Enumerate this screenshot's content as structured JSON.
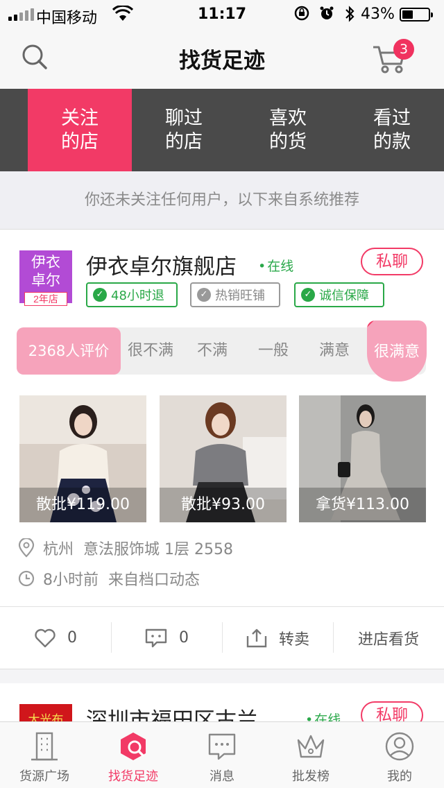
{
  "status_bar": {
    "carrier": "中国移动",
    "time": "11:17",
    "battery_pct": "43%",
    "battery_level": 0.43,
    "icons": [
      "signal-icon",
      "wifi-icon",
      "rotation-lock-icon",
      "alarm-icon",
      "bluetooth-icon",
      "battery-icon"
    ]
  },
  "header": {
    "title": "找货足迹",
    "cart_count": "3",
    "icons": [
      "search-icon",
      "cart-icon"
    ]
  },
  "tabs": [
    {
      "label": "关注\n的店",
      "active": true
    },
    {
      "label": "聊过\n的店",
      "active": false
    },
    {
      "label": "喜欢\n的货",
      "active": false
    },
    {
      "label": "看过\n的款",
      "active": false
    }
  ],
  "notice": "你还未关注任何用户，以下来自系统推荐",
  "shops": [
    {
      "logo_text": "伊衣\n卓尔",
      "years_badge": "2年店",
      "name": "伊衣卓尔旗舰店",
      "status": "在线",
      "chat_label": "私聊",
      "badges": [
        {
          "label": "48小时退",
          "active": true
        },
        {
          "label": "热销旺铺",
          "active": false
        },
        {
          "label": "诚信保障",
          "active": true
        }
      ],
      "rating": {
        "count_label": "2368人评价",
        "options": [
          "很不满",
          "不满",
          "一般",
          "满意",
          "很满意"
        ],
        "selected": "很满意"
      },
      "products": [
        {
          "price": "散批¥119.00",
          "colors": {
            "bg": "#d9cfc6",
            "dress": "#1e2440",
            "top": "#f5efe6"
          }
        },
        {
          "price": "散批¥93.00",
          "colors": {
            "bg": "#e2dcd6",
            "dress": "#2a2a2c",
            "top": "#7c7c80"
          }
        },
        {
          "price": "拿货¥113.00",
          "colors": {
            "bg": "#9a9a98",
            "dress": "#c9c5bf",
            "top": "#c9c5bf"
          }
        }
      ],
      "location": "杭州  意法服饰城 1层 2558",
      "activity": "8小时前  来自档口动态",
      "actions": {
        "likes": "0",
        "comments": "0",
        "resell": "转卖",
        "visit": "进店看货"
      }
    },
    {
      "logo_text": "大光布",
      "name": "深圳市福田区古兰",
      "status": "在线",
      "chat_label": "私聊"
    }
  ],
  "tab_bar": [
    {
      "label": "货源广场",
      "icon": "building-icon",
      "active": false
    },
    {
      "label": "找货足迹",
      "icon": "footprint-search-icon",
      "active": true
    },
    {
      "label": "消息",
      "icon": "message-icon",
      "active": false
    },
    {
      "label": "批发榜",
      "icon": "crown-icon",
      "active": false
    },
    {
      "label": "我的",
      "icon": "user-icon",
      "active": false
    }
  ],
  "colors": {
    "accent": "#f23a66",
    "tab_bg": "#4a4a4a",
    "online": "#29a847",
    "rating_pink": "#f6a3bb"
  }
}
